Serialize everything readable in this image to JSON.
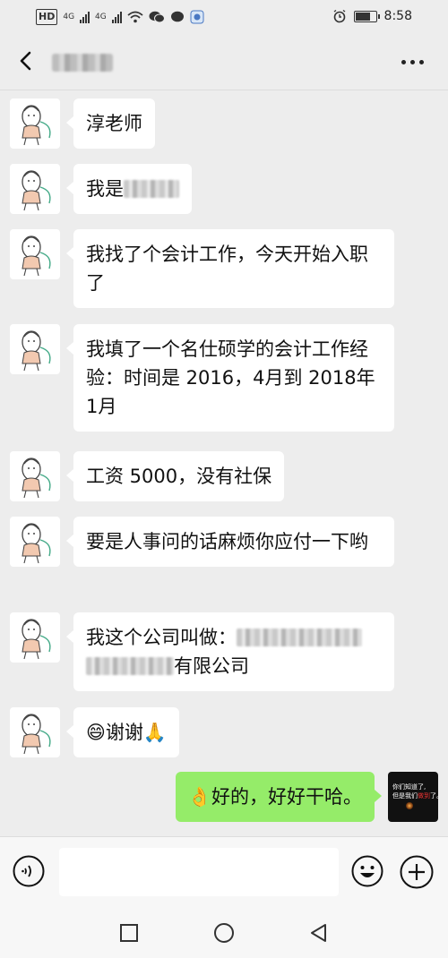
{
  "status_bar": {
    "left_labels": [
      "HD",
      "4G",
      "4G"
    ],
    "time": "8:58",
    "battery_level": 0.8
  },
  "header": {
    "contact_name_visible": false
  },
  "messages": [
    {
      "from": "contact",
      "text": "淳老师"
    },
    {
      "from": "contact",
      "text": "我是"
    },
    {
      "from": "contact",
      "text": "我找了个会计工作，今天开始入职了"
    },
    {
      "from": "contact",
      "text": "我填了一个名仕硕学的会计工作经验：时间是 2016，4月到 2018年 1月"
    },
    {
      "from": "contact",
      "text": "工资 5000，没有社保"
    },
    {
      "from": "contact",
      "text": "要是人事问的话麻烦你应付一下哟"
    },
    {
      "from": "contact",
      "text_prefix": "我这个公司叫做：",
      "text_suffix": "有限公司"
    },
    {
      "from": "contact",
      "emoji_left": "😄",
      "text": "谢谢",
      "emoji_right": "🙏"
    },
    {
      "from": "me",
      "emoji_left": "👌",
      "text": "好的，好好干哈。"
    }
  ],
  "my_avatar": {
    "line1": "你们知道了,",
    "line2": "但是我们",
    "highlight": "做到",
    "line2_end": "了。"
  },
  "icons": {
    "back": "back-arrow-icon",
    "more": "more-dots-icon",
    "voice": "voice-icon",
    "emoji": "emoji-icon",
    "plus": "plus-icon",
    "nav_recent": "square-icon",
    "nav_home": "circle-icon",
    "nav_back": "triangle-back-icon"
  },
  "colors": {
    "my_bubble": "#95ec69",
    "other_bubble": "#ffffff",
    "background": "#ededed"
  }
}
